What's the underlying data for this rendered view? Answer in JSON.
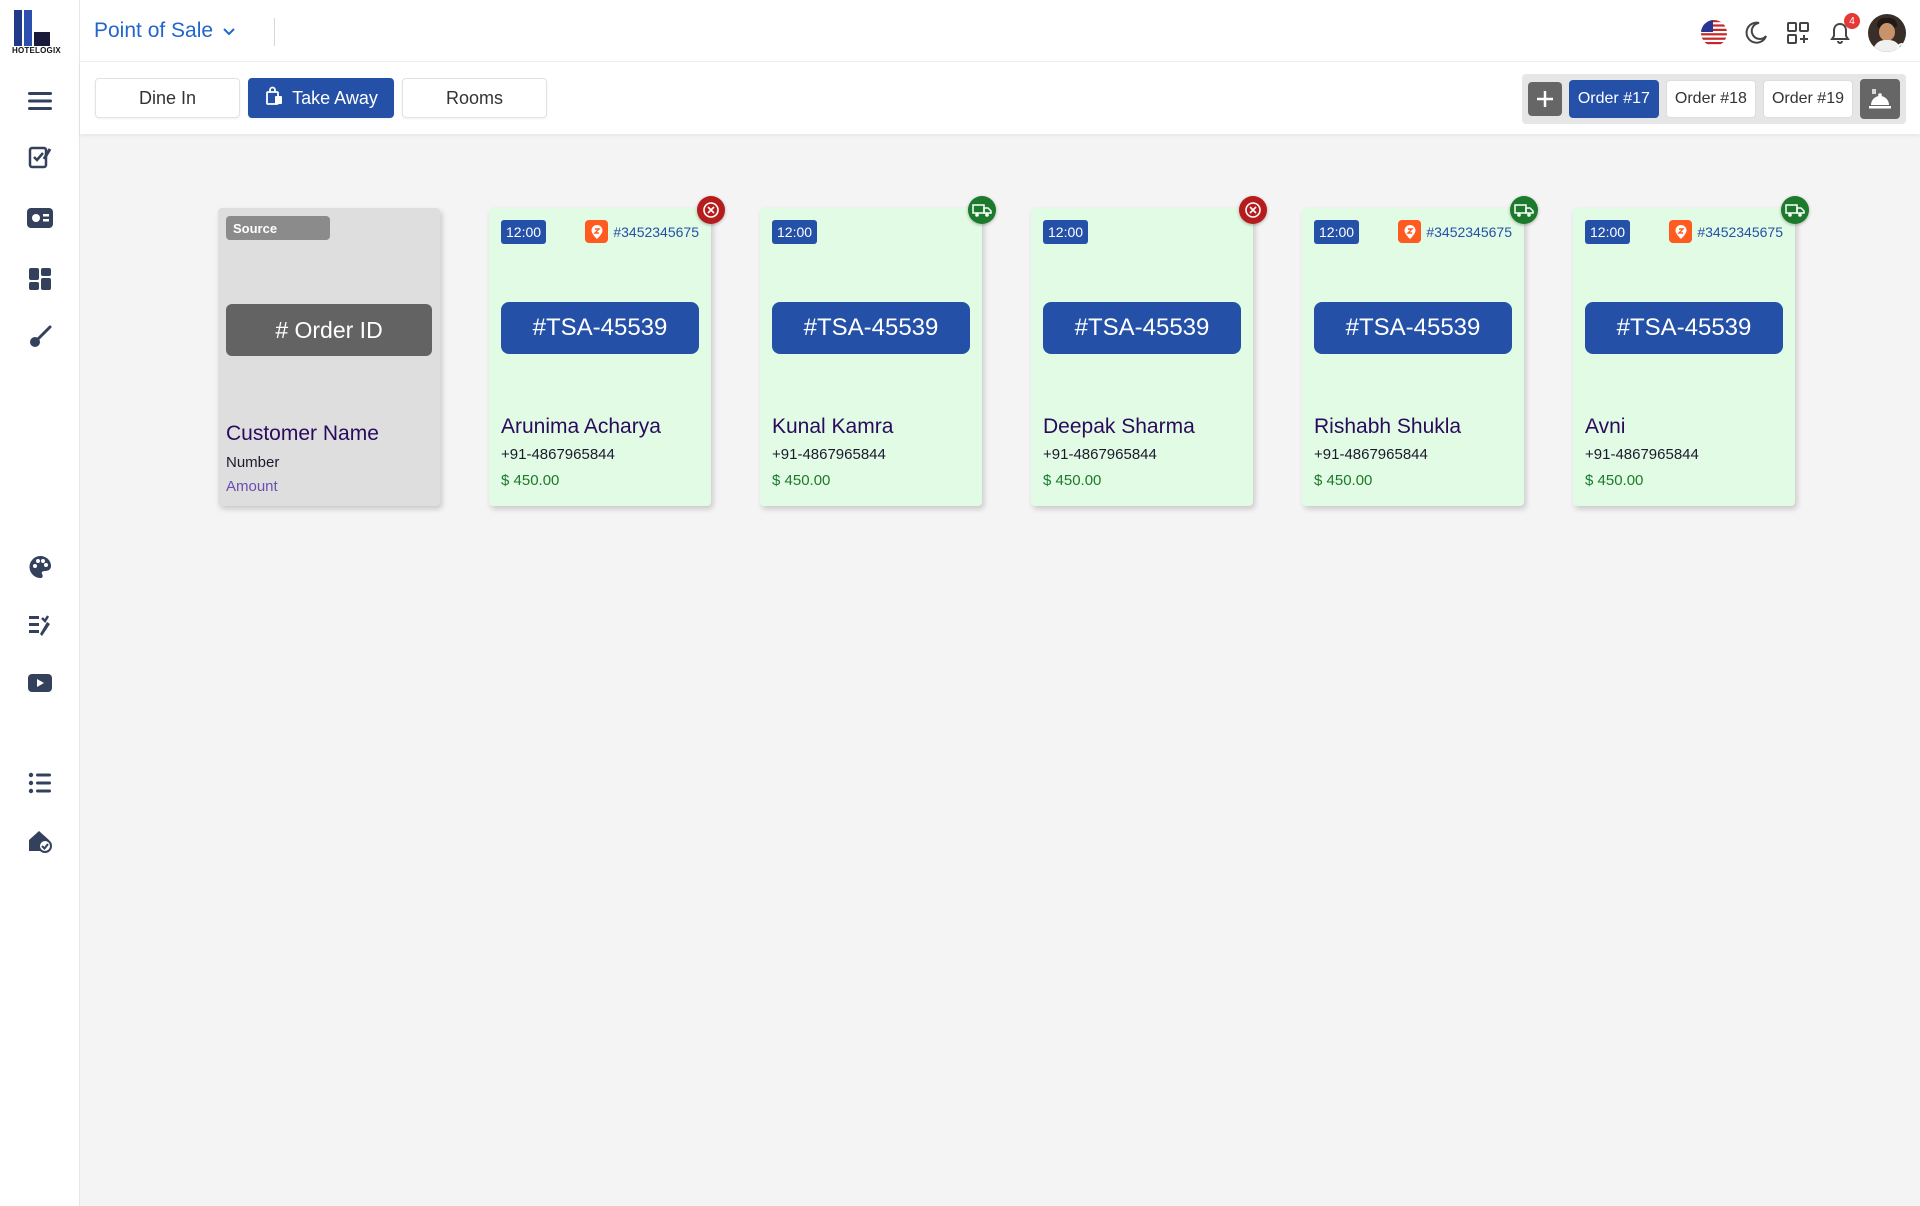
{
  "logo": {
    "text": "HOTELOGIX"
  },
  "header": {
    "title": "Point of Sale",
    "notification_count": "4"
  },
  "sidebar": {
    "icons": [
      "menu-icon",
      "order-edit-icon",
      "dashboard-card-icon",
      "widgets-icon",
      "brush-icon",
      "palette-icon",
      "report-icon",
      "video-icon",
      "list-icon",
      "property-check-icon"
    ]
  },
  "tabs": [
    {
      "label": "Dine In"
    },
    {
      "label": "Take Away"
    },
    {
      "label": "Rooms"
    }
  ],
  "orders": [
    {
      "label": "Order #17"
    },
    {
      "label": "Order #18"
    },
    {
      "label": "Order #19"
    }
  ],
  "legend": {
    "source": "Source",
    "order_id": "# Order ID",
    "customer": "Customer Name",
    "number": "Number",
    "amount": "Amount"
  },
  "cards": [
    {
      "time": "12:00",
      "ref": "#3452345675",
      "status": "red",
      "order_id": "#TSA-45539",
      "name": "Arunima Acharya",
      "phone": "+91-4867965844",
      "amount": "$ 450.00"
    },
    {
      "time": "12:00",
      "ref": "",
      "status": "green",
      "order_id": "#TSA-45539",
      "name": "Kunal Kamra",
      "phone": "+91-4867965844",
      "amount": "$ 450.00"
    },
    {
      "time": "12:00",
      "ref": "",
      "status": "red",
      "order_id": "#TSA-45539",
      "name": "Deepak Sharma",
      "phone": "+91-4867965844",
      "amount": "$ 450.00"
    },
    {
      "time": "12:00",
      "ref": "#3452345675",
      "status": "green",
      "order_id": "#TSA-45539",
      "name": "Rishabh Shukla",
      "phone": "+91-4867965844",
      "amount": "$ 450.00"
    },
    {
      "time": "12:00",
      "ref": "#3452345675",
      "status": "green",
      "order_id": "#TSA-45539",
      "name": "Avni",
      "phone": "+91-4867965844",
      "amount": "$ 450.00"
    }
  ],
  "colors": {
    "primary": "#2450a8",
    "card_bg": "#e2fbe4",
    "status_red": "#b71c1c",
    "status_green": "#1b7a2b",
    "source_orange": "#ff5a1f"
  }
}
